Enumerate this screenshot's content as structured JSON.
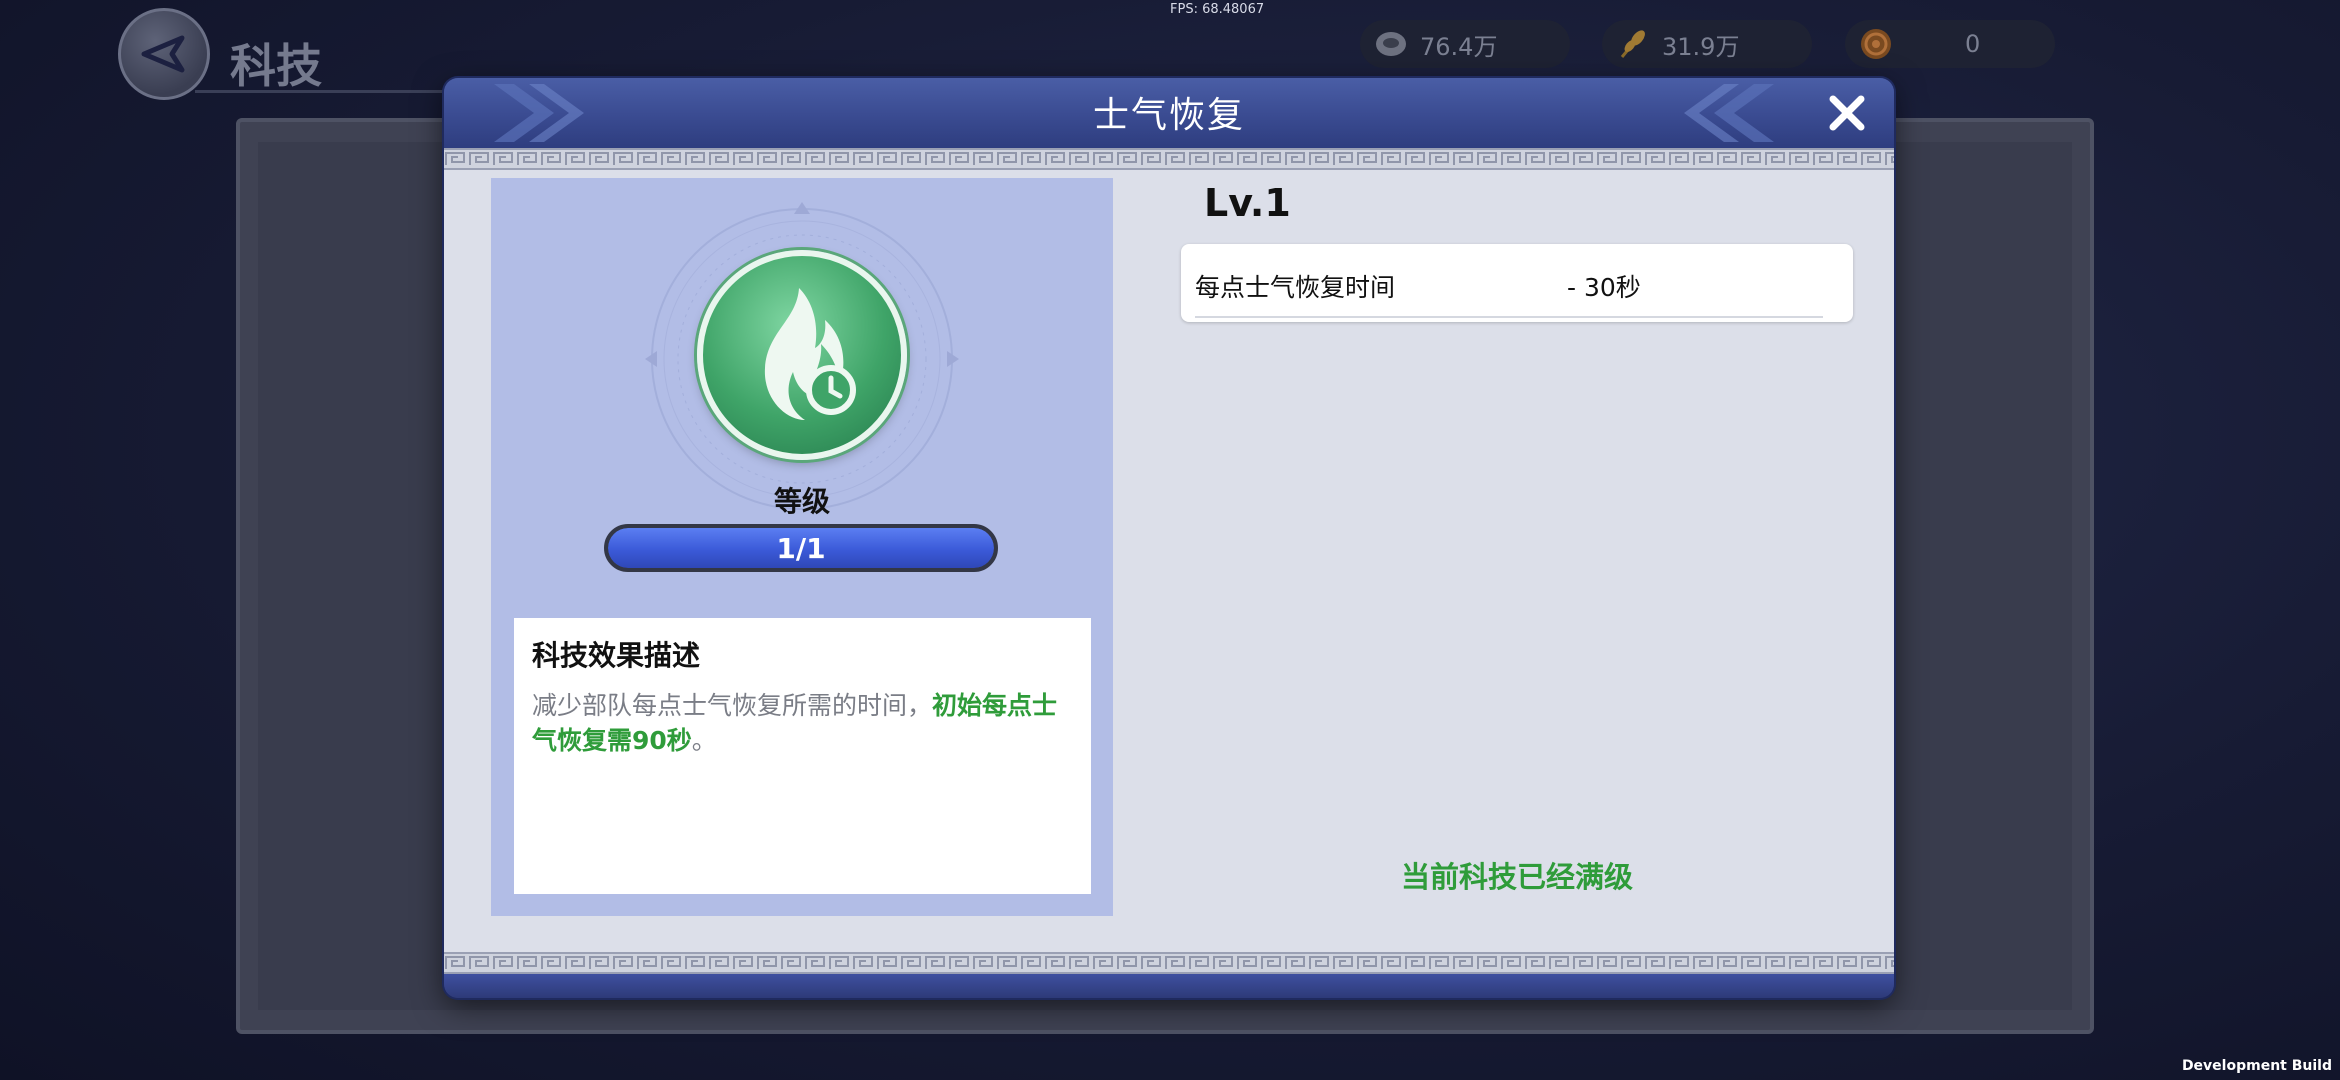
{
  "hud": {
    "fps": "FPS: 68.48067",
    "page_title": "科技",
    "resources": [
      {
        "icon": "coin-icon",
        "value": "76.4万"
      },
      {
        "icon": "grain-icon",
        "value": "31.9万"
      },
      {
        "icon": "gold-medal-icon",
        "value": "0"
      }
    ],
    "dev_build": "Development Build"
  },
  "modal": {
    "title": "士气恢复",
    "left": {
      "icon": "morale-flame-clock-icon",
      "level_label": "等级",
      "level_text": "1/1",
      "level_progress": 1.0,
      "desc_title": "科技效果描述",
      "desc_main": "减少部队每点士气恢复所需的时间，",
      "desc_highlight": "初始每点士气恢复需90秒",
      "desc_end": "。"
    },
    "right": {
      "lv": "Lv.1",
      "stat_label": "每点士气恢复时间",
      "stat_value": "- 30秒",
      "max_text": "当前科技已经满级"
    }
  },
  "colors": {
    "modal_frame": "#2d3a78",
    "header": "#3a4b91",
    "left_panel": "#b2bde6",
    "level_fill": "#3b5ad8",
    "green_text": "#2f9c3a",
    "emblem": "#3fa468"
  }
}
